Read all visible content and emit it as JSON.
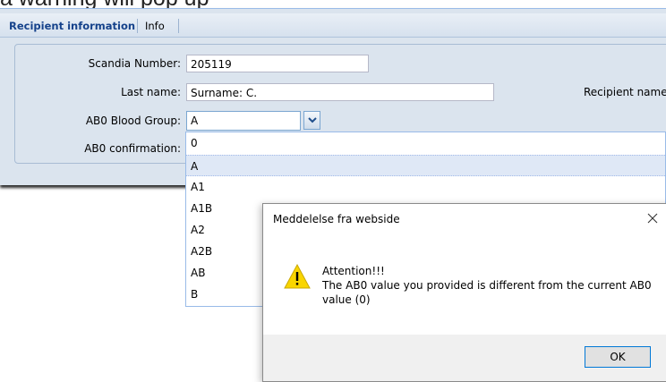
{
  "caption": "a warning will pop up",
  "tabs": [
    {
      "label": "Recipient information",
      "active": true
    },
    {
      "label": "Info",
      "active": false
    }
  ],
  "form": {
    "scandia_label": "Scandia Number:",
    "scandia_value": "205119",
    "lastname_label": "Last name:",
    "lastname_value": "Surname: C.",
    "recipient_name_label": "Recipient name",
    "blood_group_label": "AB0 Blood Group:",
    "blood_group_value": "A",
    "confirmation_label": "AB0 confirmation:"
  },
  "dropdown": {
    "options": [
      "0",
      "A",
      "A1",
      "A1B",
      "A2",
      "A2B",
      "AB",
      "B"
    ],
    "selected": "A"
  },
  "dialog": {
    "title": "Meddelelse fra webside",
    "message_line1": "Attention!!!",
    "message_line2": "The AB0 value you provided is different from the current AB0",
    "message_line3": "value (0)",
    "ok_label": "OK",
    "icon": "warning-icon"
  },
  "colors": {
    "panel_bg": "#dbe4ee",
    "active_tab_text": "#15428b",
    "selected_option_bg": "#dfe8f6",
    "dialog_footer_bg": "#f0f0f0",
    "ok_border": "#0078d7",
    "warning_yellow": "#f9d500"
  }
}
